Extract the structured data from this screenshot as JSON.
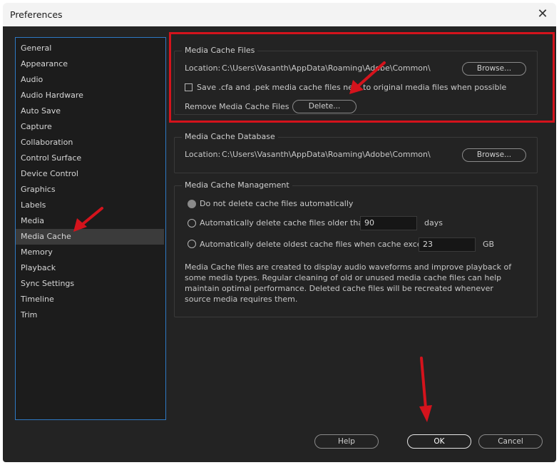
{
  "window": {
    "title": "Preferences",
    "close_glyph": "✕"
  },
  "sidebar": {
    "items": [
      {
        "label": "General"
      },
      {
        "label": "Appearance"
      },
      {
        "label": "Audio"
      },
      {
        "label": "Audio Hardware"
      },
      {
        "label": "Auto Save"
      },
      {
        "label": "Capture"
      },
      {
        "label": "Collaboration"
      },
      {
        "label": "Control Surface"
      },
      {
        "label": "Device Control"
      },
      {
        "label": "Graphics"
      },
      {
        "label": "Labels"
      },
      {
        "label": "Media"
      },
      {
        "label": "Media Cache",
        "selected": true
      },
      {
        "label": "Memory"
      },
      {
        "label": "Playback"
      },
      {
        "label": "Sync Settings"
      },
      {
        "label": "Timeline"
      },
      {
        "label": "Trim"
      }
    ]
  },
  "cache_files": {
    "title": "Media Cache Files",
    "location_label": "Location:",
    "location_path": "C:\\Users\\Vasanth\\AppData\\Roaming\\Adobe\\Common\\",
    "browse_label": "Browse...",
    "save_next_label": "Save .cfa and .pek media cache files next to original media files when possible",
    "remove_label": "Remove Media Cache Files",
    "delete_label": "Delete..."
  },
  "cache_db": {
    "title": "Media Cache Database",
    "location_label": "Location:",
    "location_path": "C:\\Users\\Vasanth\\AppData\\Roaming\\Adobe\\Common\\",
    "browse_label": "Browse..."
  },
  "management": {
    "title": "Media Cache Management",
    "option_none": "Do not delete cache files automatically",
    "option_older": "Automatically delete cache files older than:",
    "older_value": "90",
    "older_unit": "days",
    "option_exceeds": "Automatically delete oldest cache files when cache exceeds:",
    "exceeds_value": "23",
    "exceeds_unit": "GB",
    "note": "Media Cache files are created to display audio waveforms and improve playback of some media types.  Regular cleaning of old or unused media cache files can help maintain optimal performance. Deleted cache files will be recreated whenever source media requires them."
  },
  "footer": {
    "help_label": "Help",
    "ok_label": "OK",
    "cancel_label": "Cancel"
  },
  "colors": {
    "annotation": "#d4131c",
    "selection_border": "#2e79c4"
  }
}
